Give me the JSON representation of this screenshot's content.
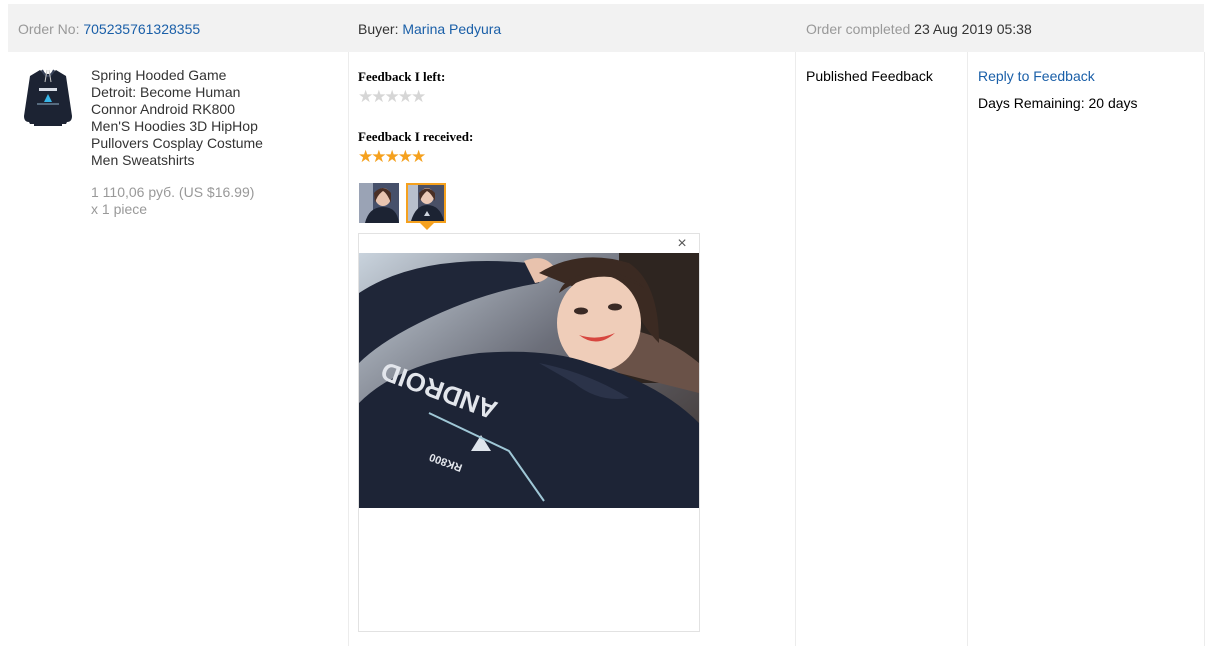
{
  "header": {
    "order_label": "Order No:",
    "order_number": "705235761328355",
    "buyer_label": "Buyer:",
    "buyer_name": "Marina Pedyura",
    "completed_label": "Order completed",
    "completed_date": "23 Aug 2019 05:38"
  },
  "product": {
    "title": "Spring Hooded Game Detroit: Become Human Connor Android RK800 Men'S Hoodies 3D HipHop Pullovers Cosplay Costume Men Sweatshirts",
    "price": "1 110,06 руб. (US $16.99)",
    "quantity": "x 1 piece",
    "thumb_icon": "hoodie-icon"
  },
  "feedback": {
    "left_heading": "Feedback I left:",
    "left_stars": "★★★★★",
    "left_rating": 0,
    "received_heading": "Feedback I received:",
    "received_stars": "★★★★★",
    "received_rating": 5,
    "photo_count": 2,
    "selected_photo": 2,
    "close_icon": "×"
  },
  "status": {
    "published": "Published Feedback",
    "reply_link": "Reply to Feedback",
    "days_remaining": "Days Remaining: 20 days"
  },
  "colors": {
    "link": "#1a5fa8",
    "star_active": "#f5a11e",
    "star_inactive": "#d6d6d6",
    "header_bg": "#f2f2f2"
  }
}
